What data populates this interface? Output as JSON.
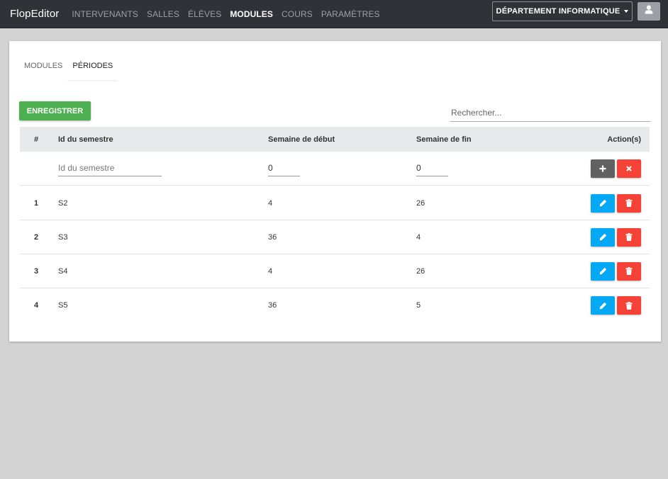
{
  "navbar": {
    "brand": "FlopEditor",
    "links": [
      "INTERVENANTS",
      "SALLES",
      "ÉLÈVES",
      "MODULES",
      "COURS",
      "PARAMÈTRES"
    ],
    "active_link": "MODULES",
    "department": "DÉPARTEMENT INFORMATIQUE",
    "user_icon": "user-icon"
  },
  "tabs": [
    "MODULES",
    "PÉRIODES"
  ],
  "active_tab": "PÉRIODES",
  "toolbar": {
    "save_label": "ENREGISTRER",
    "search_placeholder": "Rechercher..."
  },
  "table": {
    "headers": {
      "index": "#",
      "semester": "Id du semestre",
      "start_week": "Semaine de début",
      "end_week": "Semaine de fin",
      "actions": "Action(s)"
    },
    "new_row": {
      "semester_placeholder": "Id du semestre",
      "start_week": "0",
      "end_week": "0",
      "add_icon": "plus-icon",
      "cancel_icon": "close-icon"
    },
    "rows": [
      {
        "index": "1",
        "semester": "S2",
        "start_week": "4",
        "end_week": "26"
      },
      {
        "index": "2",
        "semester": "S3",
        "start_week": "36",
        "end_week": "4"
      },
      {
        "index": "3",
        "semester": "S4",
        "start_week": "4",
        "end_week": "26"
      },
      {
        "index": "4",
        "semester": "S5",
        "start_week": "36",
        "end_week": "5"
      }
    ],
    "row_actions": {
      "edit_icon": "pencil-icon",
      "delete_icon": "trash-icon"
    }
  },
  "colors": {
    "navbar_bg": "#2f3237",
    "save_green": "#4caf50",
    "edit_blue": "#03a9f4",
    "delete_red": "#f44336",
    "add_grey": "#616161",
    "page_bg": "#d3d3d3"
  }
}
